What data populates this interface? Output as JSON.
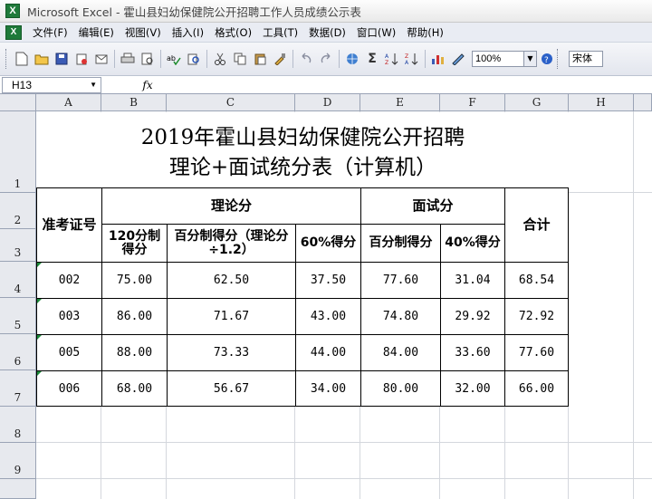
{
  "window": {
    "title": "Microsoft Excel - 霍山县妇幼保健院公开招聘工作人员成绩公示表",
    "app_icon": "excel-icon"
  },
  "menu": [
    "文件(F)",
    "编辑(E)",
    "视图(V)",
    "插入(I)",
    "格式(O)",
    "工具(T)",
    "数据(D)",
    "窗口(W)",
    "帮助(H)"
  ],
  "toolbar": {
    "zoom": "100%",
    "font": "宋体"
  },
  "formula_bar": {
    "name_box": "H13",
    "fx": "fx",
    "formula": ""
  },
  "columns": [
    "A",
    "B",
    "C",
    "D",
    "E",
    "F",
    "G",
    "H"
  ],
  "rows": [
    "1",
    "2",
    "3",
    "4",
    "5",
    "6",
    "7",
    "8",
    "9"
  ],
  "sheet": {
    "title_line1": "2019年霍山县妇幼保健院公开招聘",
    "title_line2": "理论+面试统分表（计算机）",
    "header": {
      "exam_no": "准考证号",
      "theory": "理论分",
      "interview": "面试分",
      "total": "合计",
      "sub_b": "120分制得分",
      "sub_c": "百分制得分（理论分÷1.2）",
      "sub_d": "60%得分",
      "sub_e": "百分制得分",
      "sub_f": "40%得分"
    },
    "data": [
      [
        "002",
        "75.00",
        "62.50",
        "37.50",
        "77.60",
        "31.04",
        "68.54"
      ],
      [
        "003",
        "86.00",
        "71.67",
        "43.00",
        "74.80",
        "29.92",
        "72.92"
      ],
      [
        "005",
        "88.00",
        "73.33",
        "44.00",
        "84.00",
        "33.60",
        "77.60"
      ],
      [
        "006",
        "68.00",
        "56.67",
        "34.00",
        "80.00",
        "32.00",
        "66.00"
      ]
    ]
  }
}
